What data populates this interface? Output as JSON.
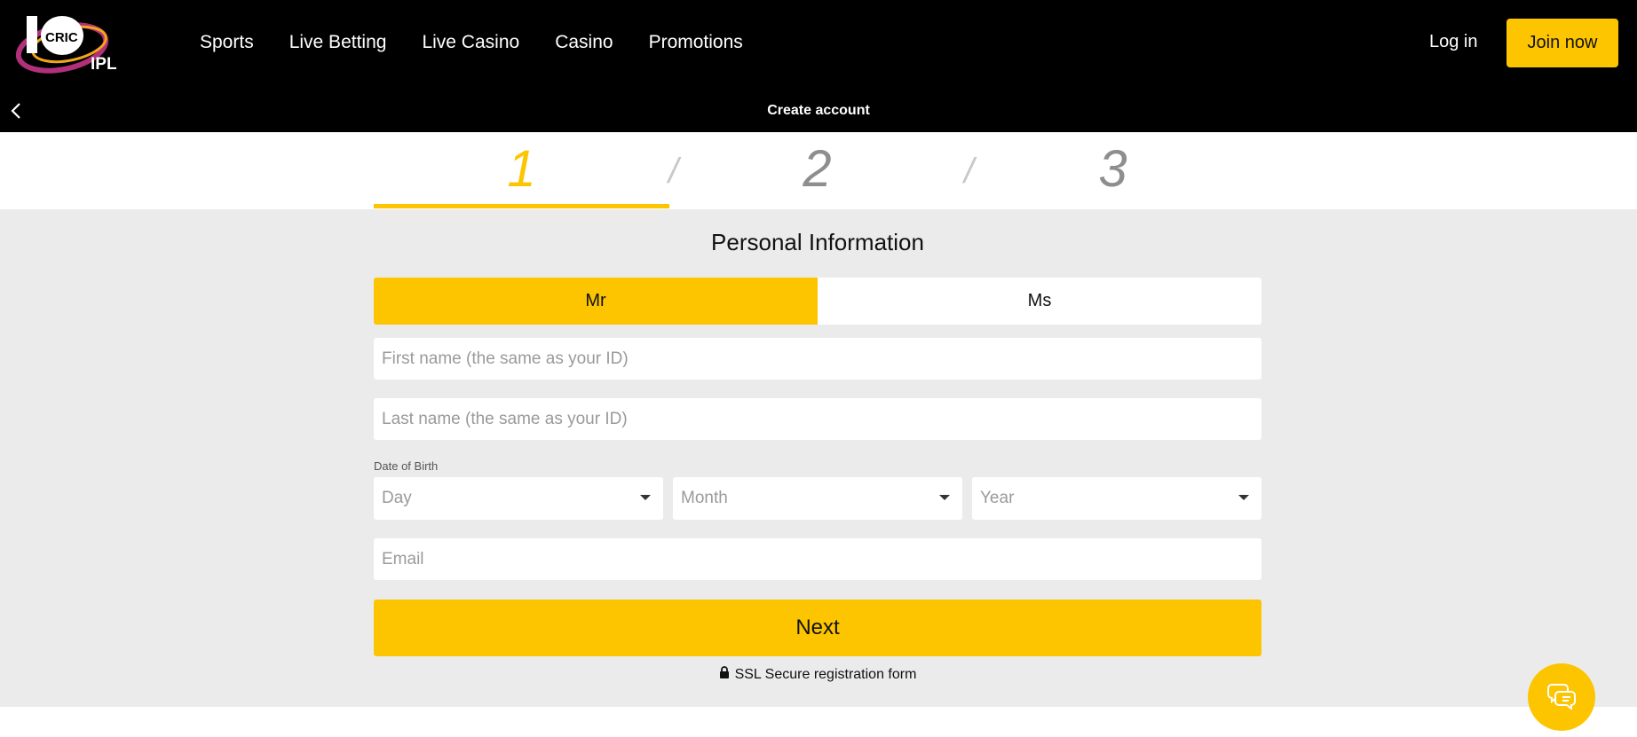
{
  "header": {
    "brand": "10 CRIC IPL",
    "nav": [
      "Sports",
      "Live Betting",
      "Live Casino",
      "Casino",
      "Promotions"
    ],
    "login_label": "Log in",
    "join_label": "Join now",
    "page_title": "Create account"
  },
  "steps": {
    "items": [
      "1",
      "2",
      "3"
    ],
    "active": 1
  },
  "form": {
    "section_title": "Personal Information",
    "gender": {
      "options": [
        "Mr",
        "Ms"
      ],
      "selected": "Mr"
    },
    "first_name": {
      "placeholder": "First name (the same as your ID)",
      "value": ""
    },
    "last_name": {
      "placeholder": "Last name (the same as your ID)",
      "value": ""
    },
    "dob": {
      "label": "Date of Birth",
      "day": "Day",
      "month": "Month",
      "year": "Year"
    },
    "email": {
      "placeholder": "Email",
      "value": ""
    },
    "next_label": "Next",
    "secure_text": "SSL Secure registration form"
  },
  "icons": {
    "back": "chevron-left-icon",
    "lock": "lock-icon",
    "chat": "chat-icon"
  },
  "colors": {
    "accent": "#fdc400",
    "header_bg": "#000000",
    "form_bg": "#ebebeb"
  }
}
